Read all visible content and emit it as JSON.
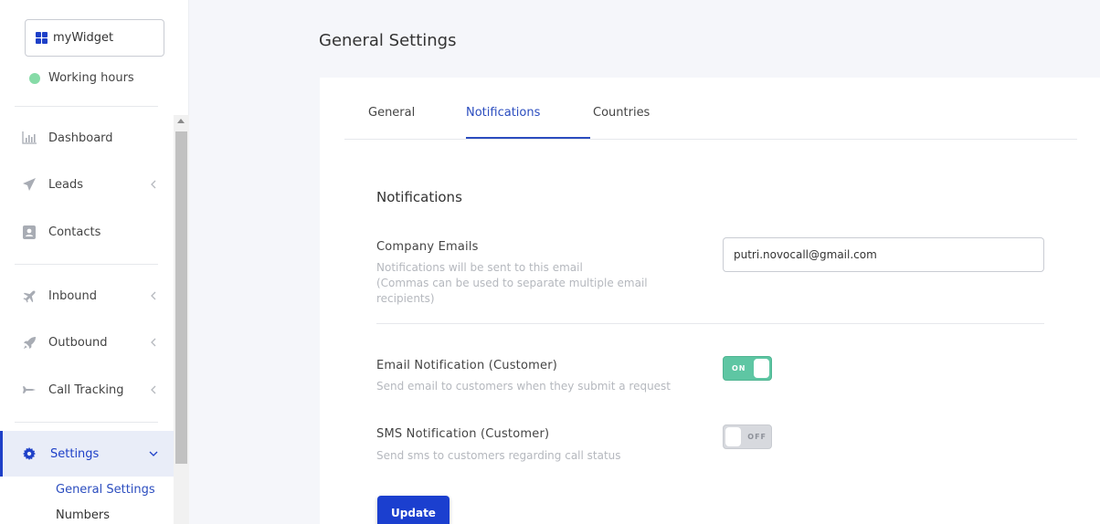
{
  "sidebar": {
    "widget": {
      "label": "myWidget",
      "icon": "grid-icon"
    },
    "working_hours": {
      "label": "Working hours",
      "status_color": "#86dba7"
    },
    "items": [
      {
        "label": "Dashboard",
        "icon": "bar-chart-icon"
      },
      {
        "label": "Leads",
        "icon": "paper-plane-icon"
      },
      {
        "label": "Contacts",
        "icon": "contact-card-icon"
      },
      {
        "label": "Inbound",
        "icon": "airplane-icon"
      },
      {
        "label": "Outbound",
        "icon": "rocket-icon"
      },
      {
        "label": "Call Tracking",
        "icon": "tracking-icon"
      },
      {
        "label": "Settings",
        "icon": "gear-icon"
      }
    ],
    "sub_items": [
      {
        "label": "General Settings",
        "color": "#2b4dbf"
      },
      {
        "label": "Numbers",
        "color": "#333333"
      }
    ]
  },
  "page": {
    "title": "General Settings"
  },
  "tabs": [
    {
      "label": "General"
    },
    {
      "label": "Notifications"
    },
    {
      "label": "Countries"
    }
  ],
  "notifications": {
    "title": "Notifications",
    "company_emails": {
      "label": "Company Emails",
      "desc1": "Notifications will be sent to this email",
      "desc2": "(Commas can be used to separate multiple email recipients)",
      "value": "putri.novocall@gmail.com"
    },
    "email_notification": {
      "label": "Email Notification (Customer)",
      "desc": "Send email to customers when they submit a request",
      "state": "ON"
    },
    "sms_notification": {
      "label": "SMS Notification (Customer)",
      "desc": "Send sms to customers regarding call status",
      "state": "OFF"
    },
    "update_label": "Update"
  },
  "colors": {
    "accent": "#1e40c8",
    "toggle_on": "#5ec6a3",
    "toggle_off": "#d7d9de"
  }
}
